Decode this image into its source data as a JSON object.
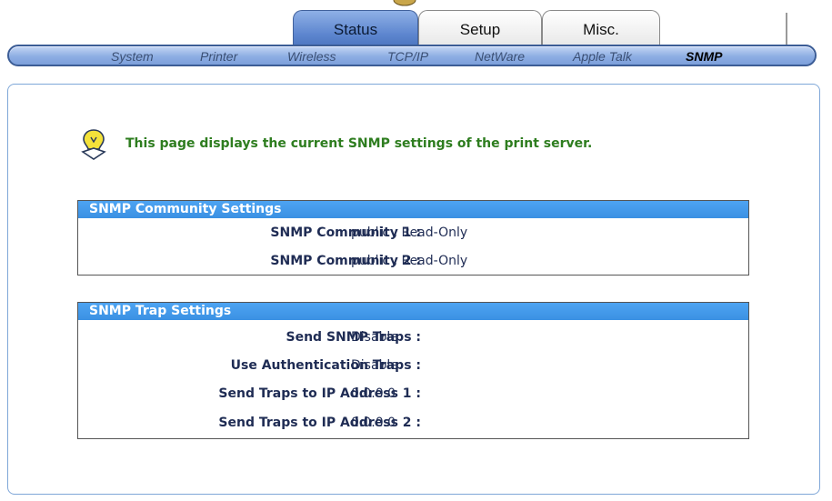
{
  "tabs": [
    {
      "label": "Status",
      "active": true
    },
    {
      "label": "Setup",
      "active": false
    },
    {
      "label": "Misc.",
      "active": false
    }
  ],
  "subnav": [
    {
      "label": "System"
    },
    {
      "label": "Printer"
    },
    {
      "label": "Wireless"
    },
    {
      "label": "TCP/IP"
    },
    {
      "label": "NetWare"
    },
    {
      "label": "Apple Talk"
    },
    {
      "label": "SNMP",
      "active": true
    }
  ],
  "intro": {
    "icon": "lightbulb-icon",
    "text": "This page displays the current SNMP settings of the print server."
  },
  "community": {
    "title": "SNMP Community Settings",
    "rows": [
      {
        "label": "SNMP Community 1 :",
        "value": "public , Read-Only"
      },
      {
        "label": "SNMP Community 2 :",
        "value": "public , Read-Only"
      }
    ]
  },
  "trap": {
    "title": "SNMP Trap Settings",
    "rows": [
      {
        "label": "Send SNMP Traps :",
        "value": "Disable"
      },
      {
        "label": "Use Authentication Traps :",
        "value": "Disable"
      },
      {
        "label": "Send Traps to IP Address 1 :",
        "value": "0.0.0.0"
      },
      {
        "label": "Send Traps to IP Address 2 :",
        "value": "0.0.0.0"
      }
    ]
  },
  "colors": {
    "accent": "#4da4f2",
    "tab_active": "#5d86cf",
    "intro_text": "#2e7d1f",
    "label_text": "#1f2c54"
  }
}
